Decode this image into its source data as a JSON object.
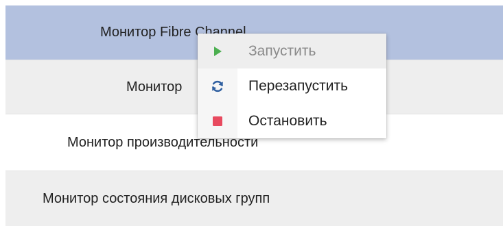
{
  "list": {
    "rows": [
      {
        "label": "Монитор Fibre Channel"
      },
      {
        "label": "Монитор"
      },
      {
        "label": "Монитор производительности"
      },
      {
        "label": "Монитор состояния дисковых групп"
      }
    ]
  },
  "context_menu": {
    "items": [
      {
        "label": "Запустить",
        "icon": "play-icon",
        "disabled": true
      },
      {
        "label": "Перезапустить",
        "icon": "refresh-icon"
      },
      {
        "label": "Остановить",
        "icon": "stop-icon"
      }
    ]
  },
  "colors": {
    "selected_row": "#b3c1df",
    "alt_row": "#eeeeee",
    "play_icon": "#4caf50",
    "refresh_icon": "#2f5fa0",
    "stop_icon": "#e84a5f"
  }
}
